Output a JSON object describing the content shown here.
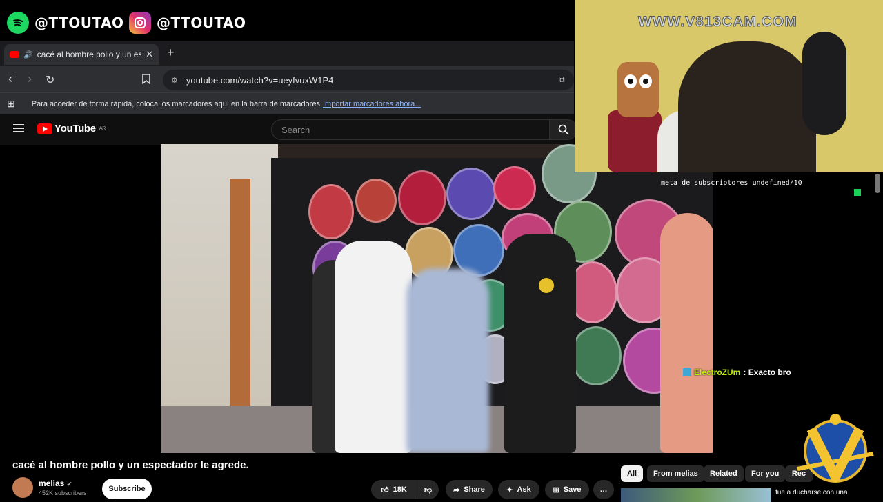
{
  "overlay": {
    "spotify_handle": "@TTOUTAO",
    "instagram_handle": "@TTOUTAO",
    "cam_watermark": "WWW.V813CAM.COM",
    "sub_goal": "meta de subscriptores undefined/10"
  },
  "browser": {
    "tab_title": "cacé al hombre pollo y un espectador le agrede",
    "new_tab": "+",
    "url": "youtube.com/watch?v=ueyfvuxW1P4",
    "bookmarks_prompt": "Para acceder de forma rápida, coloca los marcadores aquí en la barra de marcadores",
    "bookmarks_import": "Importar marcadores ahora..."
  },
  "youtube": {
    "logo": "YouTube",
    "logo_region": "AR",
    "search_placeholder": "Search"
  },
  "video": {
    "title": "cacé al hombre pollo y un espectador le agrede.",
    "channel": "melias",
    "subscribers": "452K subscribers",
    "subscribe": "Subscribe",
    "likes": "18K",
    "share": "Share",
    "ask": "Ask",
    "save": "Save",
    "more": "…"
  },
  "chat": {
    "username": "ElectroZUm",
    "message": ": Exacto bro"
  },
  "chips": [
    "All",
    "From melias",
    "Related",
    "For you",
    "Rec"
  ],
  "related": {
    "title": "fue a ducharse con una"
  },
  "colors": {
    "youtube_red": "#ff0000",
    "spotify_green": "#1ed760",
    "chat_user": "#bff000",
    "goal_marker": "#19d356"
  }
}
